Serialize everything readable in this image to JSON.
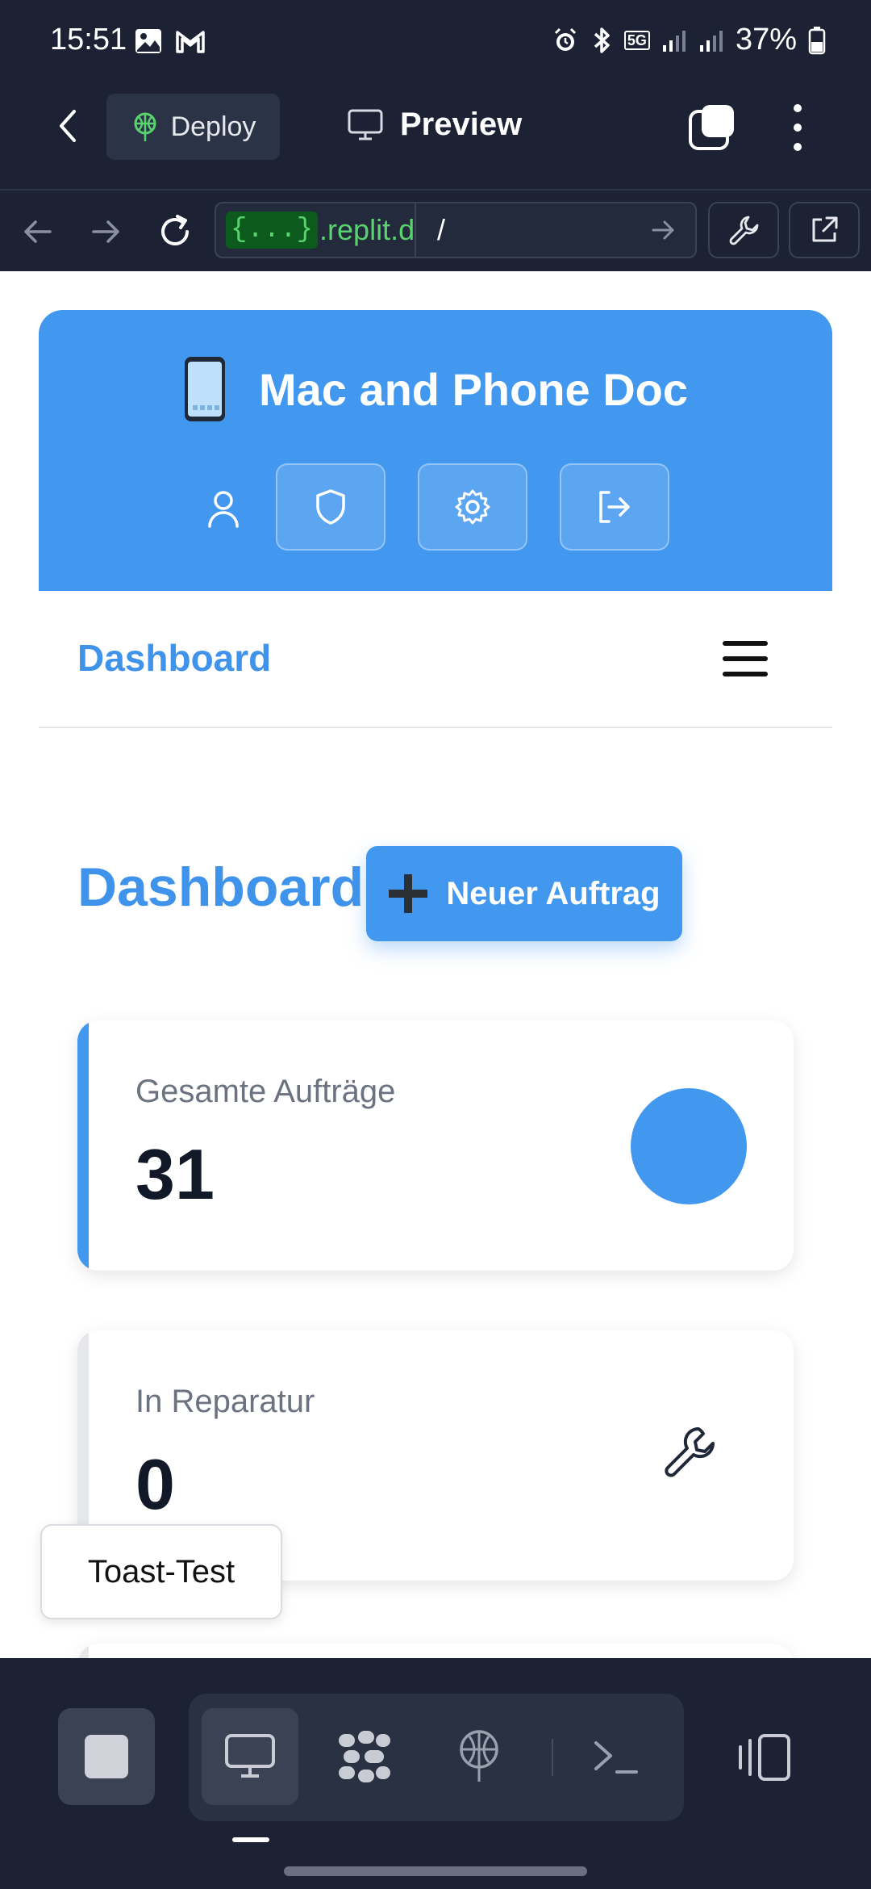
{
  "status_bar": {
    "time": "15:51",
    "battery": "37%",
    "network": "5G"
  },
  "toolbar": {
    "deploy_label": "Deploy",
    "preview_label": "Preview"
  },
  "url_bar": {
    "host_badge": "{...}",
    "host": ".replit.d",
    "path": "/"
  },
  "app": {
    "title": "Mac and Phone Doc",
    "logo_icon": "mobile-phone-emoji",
    "header_icons": [
      "user-icon",
      "shield-icon",
      "gear-icon",
      "logout-icon"
    ],
    "nav_title": "Dashboard",
    "page_title": "Dashboard",
    "new_order_button": "Neuer Auftrag",
    "new_order_icon": "plus-emoji",
    "accent_color": "#4298ef"
  },
  "stats": [
    {
      "label": "Gesamte Aufträge",
      "value": "31",
      "icon": "blue-circle",
      "accent": "#4298ef"
    },
    {
      "label": "In Reparatur",
      "value": "0",
      "icon": "wrench-icon",
      "accent": "#e5e7eb"
    }
  ],
  "toast": {
    "label": "Toast-Test"
  }
}
